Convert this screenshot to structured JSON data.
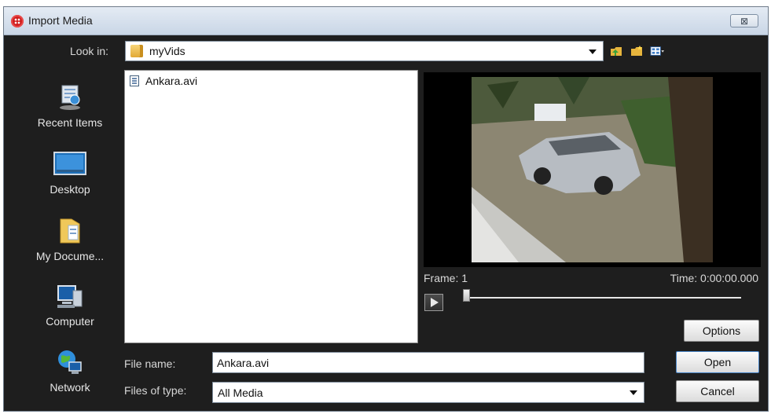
{
  "window": {
    "title": "Import Media",
    "close_glyph": "⊠"
  },
  "lookin": {
    "label": "Look in:",
    "value": "myVids"
  },
  "toolbar": {
    "icons": [
      "up-folder-icon",
      "new-folder-icon",
      "view-menu-icon"
    ]
  },
  "places": [
    {
      "label": "Recent Items",
      "icon": "recent-items-icon"
    },
    {
      "label": "Desktop",
      "icon": "desktop-icon"
    },
    {
      "label": "My Docume...",
      "icon": "my-documents-icon"
    },
    {
      "label": "Computer",
      "icon": "computer-icon"
    },
    {
      "label": "Network",
      "icon": "network-icon"
    }
  ],
  "files": [
    {
      "name": "Ankara.avi",
      "icon": "video-file-icon"
    }
  ],
  "preview": {
    "frame_label": "Frame: 1",
    "time_label": "Time: 0:00:00.000",
    "position": 0
  },
  "filename": {
    "label": "File name:",
    "value": "Ankara.avi"
  },
  "filetype": {
    "label": "Files of type:",
    "value": "All Media"
  },
  "buttons": {
    "options": "Options",
    "open": "Open",
    "cancel": "Cancel"
  }
}
